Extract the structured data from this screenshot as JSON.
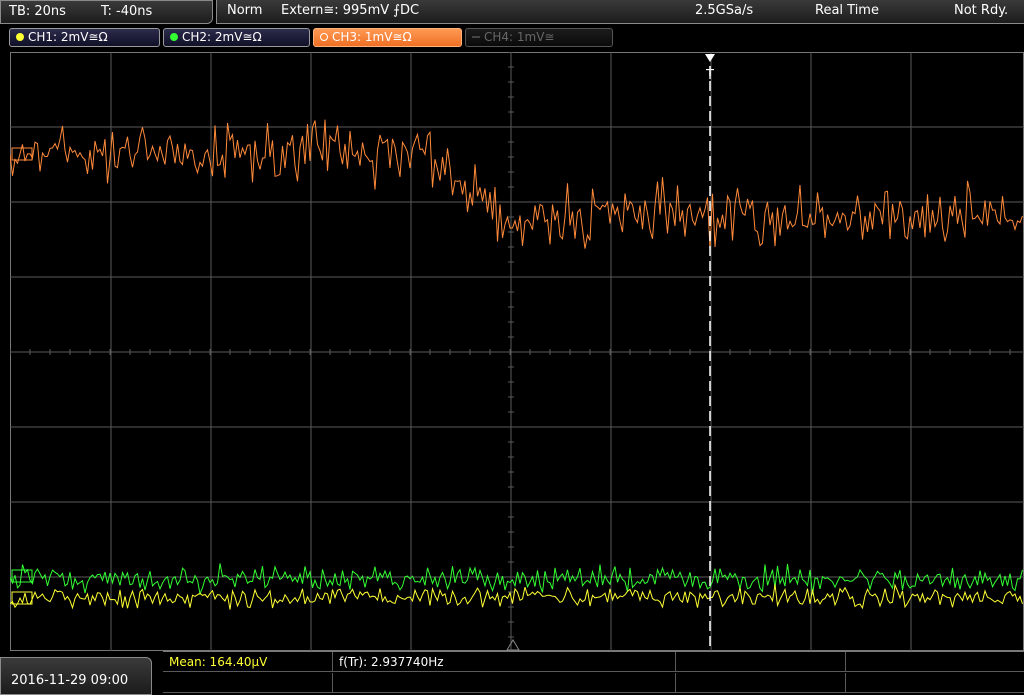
{
  "topbar": {
    "timebase": "TB: 20ns",
    "trigger_time": "T: -40ns",
    "mode": "Norm",
    "trigger_source": "Extern≅: 995mV ⨍DC",
    "sample_rate": "2.5GSa/s",
    "acquisition": "Real Time",
    "status": "Not Rdy."
  },
  "channels": [
    {
      "label": "CH1: 2mV≅Ω",
      "color": "#ffff33",
      "active": true
    },
    {
      "label": "CH2: 2mV≅Ω",
      "color": "#33ff33",
      "active": true
    },
    {
      "label": "CH3: 1mV≅Ω",
      "color": "#ff8a3a",
      "active": true
    },
    {
      "label": "CH4: 1mV≅",
      "color": "#555555",
      "active": false
    }
  ],
  "markers": {
    "trigger_label": "T"
  },
  "measurements": {
    "mean": "Mean: 164.40µV",
    "frequency": "f(Tr): 2.937740Hz"
  },
  "datetime": "2016-11-29 09:00",
  "colors": {
    "grid": "#5a5a5a",
    "ch1": "#ffff33",
    "ch2": "#33ff33",
    "ch3": "#ff8a3a",
    "trigger_line": "#ffffff"
  },
  "icons": {
    "trigger_marker": "trigger-down-arrow-icon",
    "level_marker": "level-arrow-icon"
  }
}
